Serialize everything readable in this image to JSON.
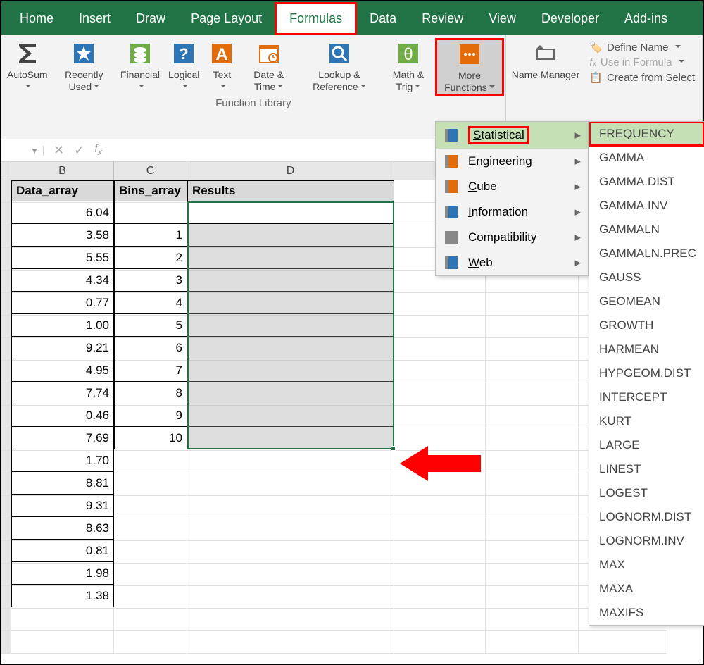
{
  "tabs": [
    "Home",
    "Insert",
    "Draw",
    "Page Layout",
    "Formulas",
    "Data",
    "Review",
    "View",
    "Developer",
    "Add-ins"
  ],
  "active_tab": "Formulas",
  "function_library_label": "Function Library",
  "ribbon_buttons": {
    "autosum": "AutoSum",
    "recently_used": "Recently Used",
    "financial": "Financial",
    "logical": "Logical",
    "text": "Text",
    "date_time": "Date & Time",
    "lookup_ref": "Lookup & Reference",
    "math_trig": "Math & Trig",
    "more_functions": "More Functions",
    "name_manager": "Name Manager"
  },
  "defined_names": {
    "define_name": "Define Name",
    "use_in_formula": "Use in Formula",
    "create_from_selection": "Create from Select"
  },
  "menu_items": [
    {
      "label": "Statistical",
      "key": "S",
      "icon_color": "#2e75b6"
    },
    {
      "label": "Engineering",
      "key": "E",
      "icon_color": "#e26b0a"
    },
    {
      "label": "Cube",
      "key": "C",
      "icon_color": "#e26b0a"
    },
    {
      "label": "Information",
      "key": "I",
      "icon_color": "#2e75b6"
    },
    {
      "label": "Compatibility",
      "key": "C",
      "icon_color": "#888"
    },
    {
      "label": "Web",
      "key": "W",
      "icon_color": "#2e75b6"
    }
  ],
  "submenu_items": [
    "FREQUENCY",
    "GAMMA",
    "GAMMA.DIST",
    "GAMMA.INV",
    "GAMMALN",
    "GAMMALN.PREC",
    "GAUSS",
    "GEOMEAN",
    "GROWTH",
    "HARMEAN",
    "HYPGEOM.DIST",
    "INTERCEPT",
    "KURT",
    "LARGE",
    "LINEST",
    "LOGEST",
    "LOGNORM.DIST",
    "LOGNORM.INV",
    "MAX",
    "MAXA",
    "MAXIFS"
  ],
  "columns": [
    "B",
    "C",
    "D"
  ],
  "table": {
    "headers": {
      "b": "Data_array",
      "c": "Bins_array",
      "d": "Results"
    },
    "rows": [
      {
        "b": "6.04",
        "c": ""
      },
      {
        "b": "3.58",
        "c": "1"
      },
      {
        "b": "5.55",
        "c": "2"
      },
      {
        "b": "4.34",
        "c": "3"
      },
      {
        "b": "0.77",
        "c": "4"
      },
      {
        "b": "1.00",
        "c": "5"
      },
      {
        "b": "9.21",
        "c": "6"
      },
      {
        "b": "4.95",
        "c": "7"
      },
      {
        "b": "7.74",
        "c": "8"
      },
      {
        "b": "0.46",
        "c": "9"
      },
      {
        "b": "7.69",
        "c": "10"
      },
      {
        "b": "1.70",
        "c": ""
      },
      {
        "b": "8.81",
        "c": ""
      },
      {
        "b": "9.31",
        "c": ""
      },
      {
        "b": "8.63",
        "c": ""
      },
      {
        "b": "0.81",
        "c": ""
      },
      {
        "b": "1.98",
        "c": ""
      },
      {
        "b": "1.38",
        "c": ""
      }
    ]
  }
}
